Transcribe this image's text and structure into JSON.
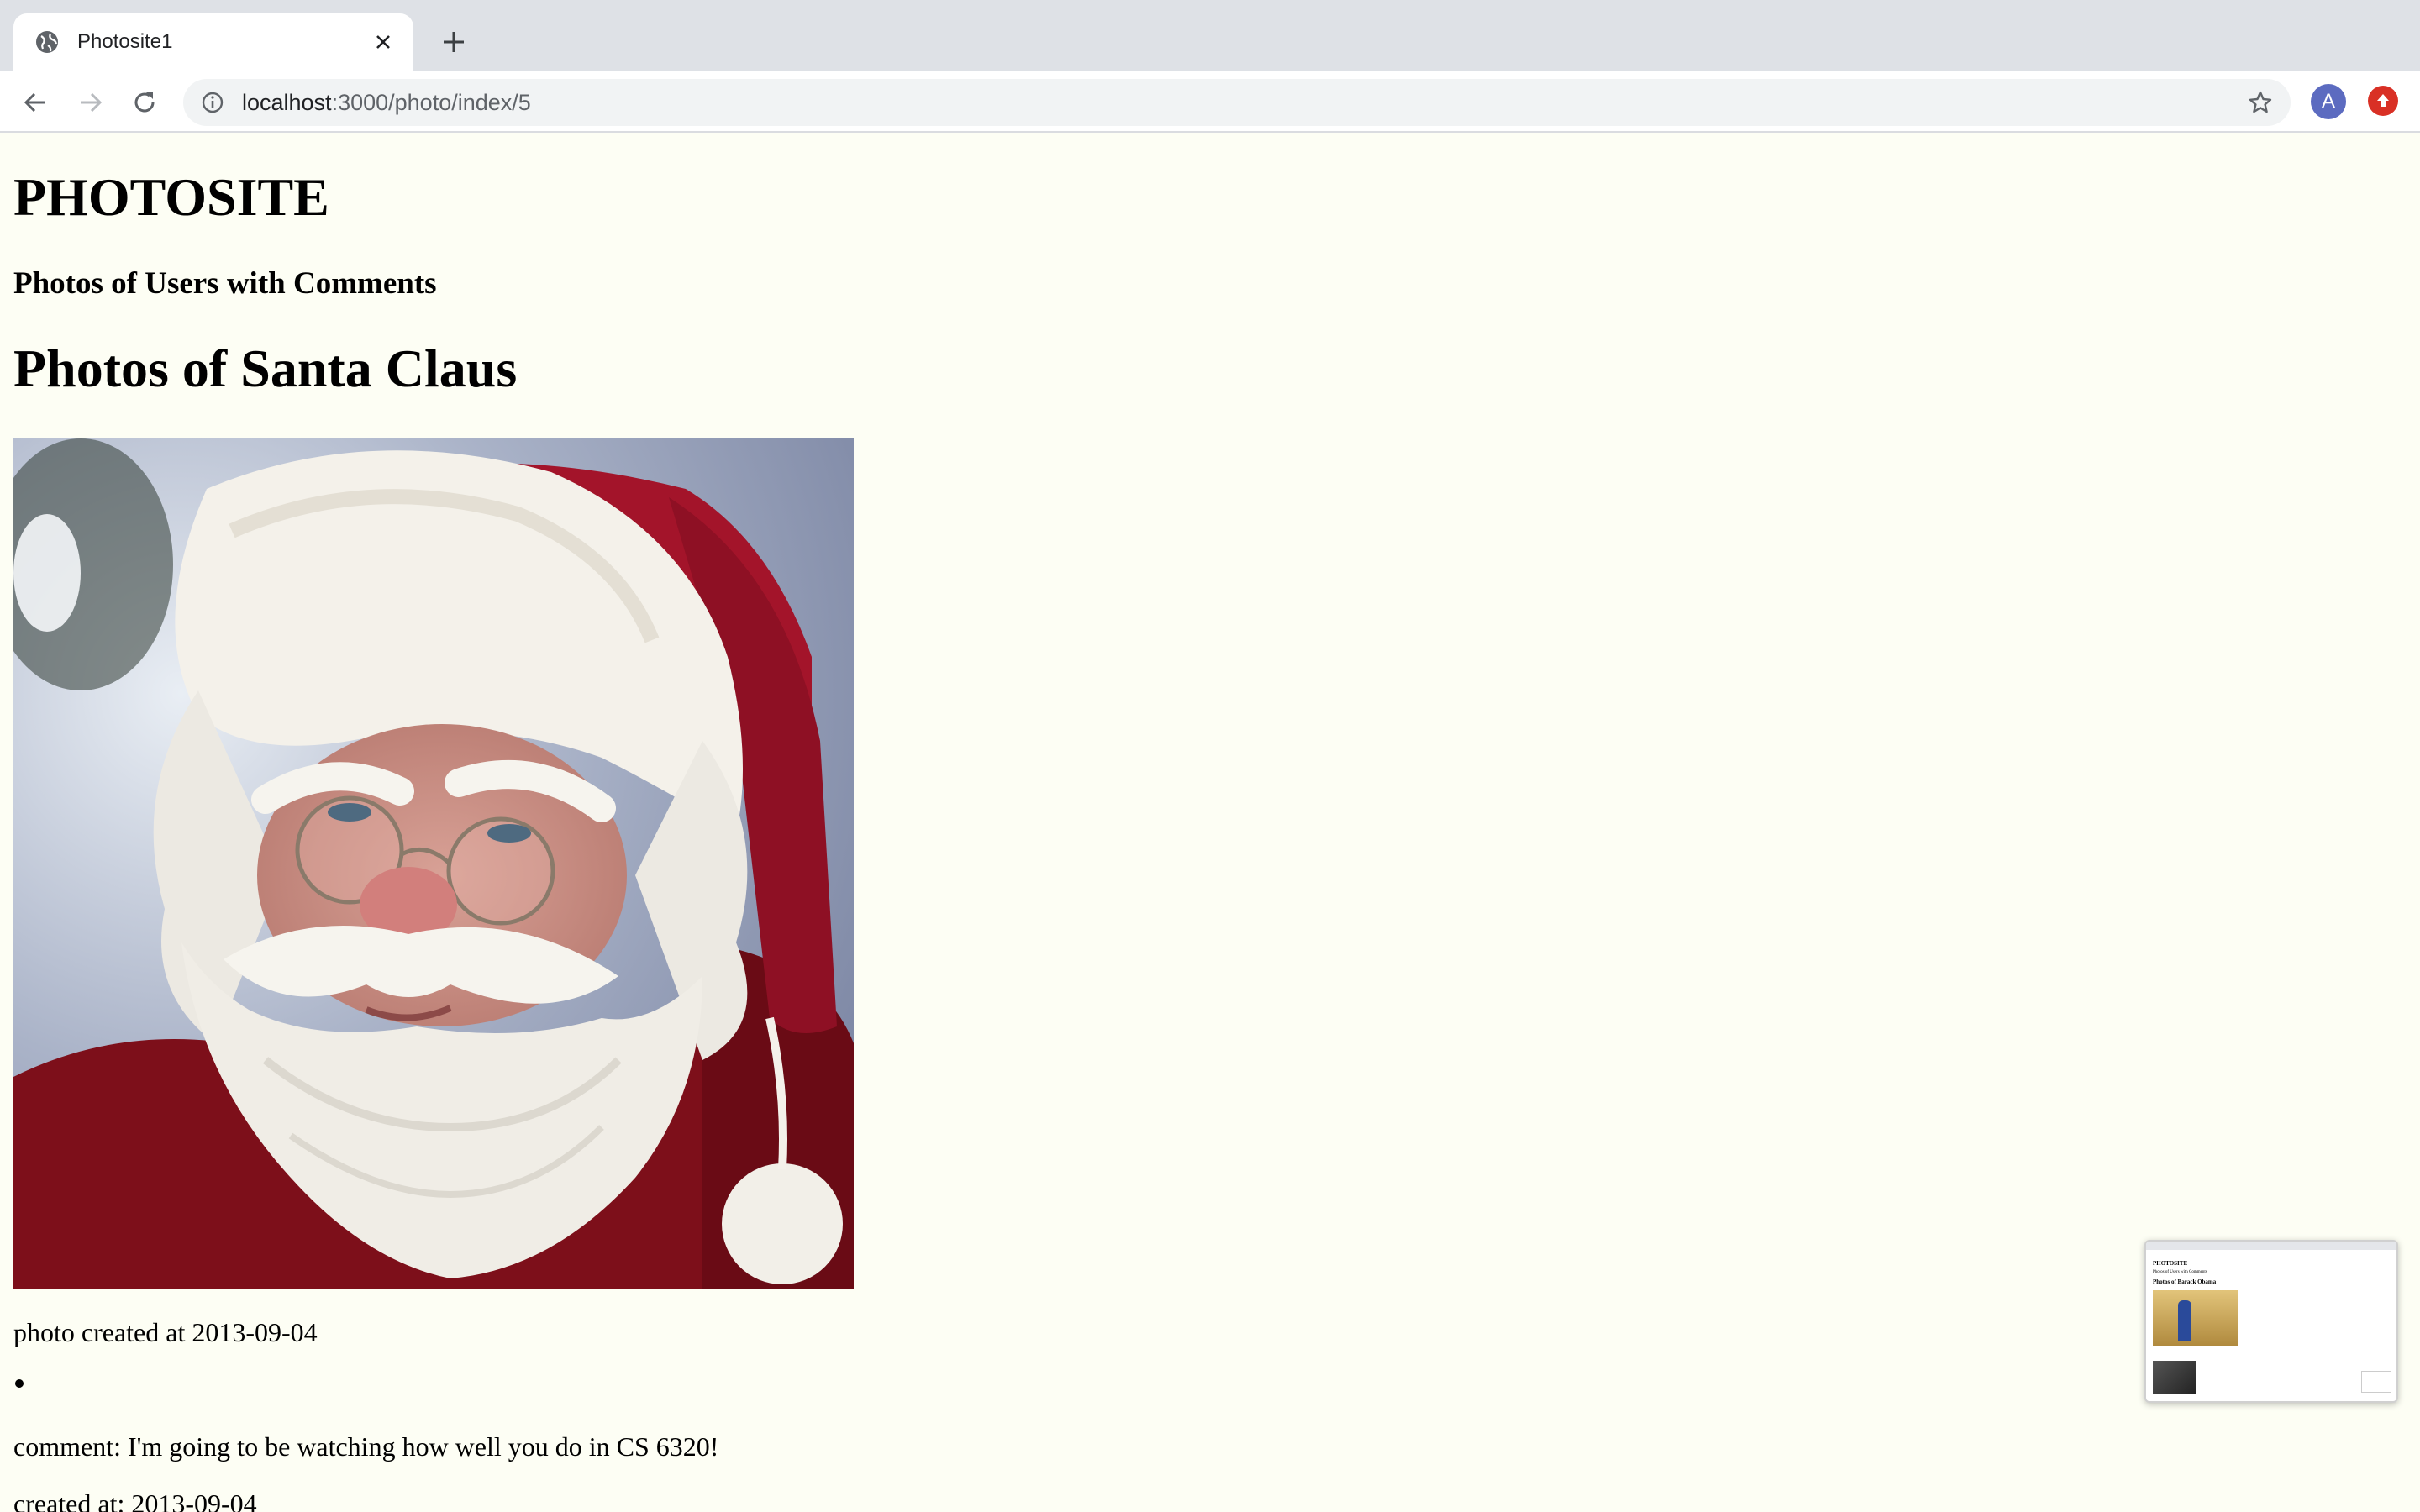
{
  "browser": {
    "tab_title": "Photosite1",
    "url_host": "localhost",
    "url_path": ":3000/photo/index/5",
    "avatar_letter": "A"
  },
  "page": {
    "site_title": "PHOTOSITE",
    "site_subtitle": "Photos of Users with Comments",
    "user_heading": "Photos of Santa Claus",
    "photo_created": "photo created at 2013-09-04",
    "comments": [
      {
        "text": "comment: I'm going to be watching how well you do in CS 6320!",
        "created": "created at: 2013-09-04"
      }
    ]
  },
  "preview": {
    "title": "PHOTOSITE",
    "subtitle": "Photos of Users with Comments",
    "heading": "Photos of Barack Obama"
  },
  "colors": {
    "page_background": "#fdfef4",
    "avatar": "#5c6bc0",
    "extension": "#d93025"
  },
  "icons": [
    "globe-icon",
    "close-icon",
    "plus-icon",
    "back-arrow-icon",
    "forward-arrow-icon",
    "reload-icon",
    "info-icon",
    "star-icon",
    "upload-icon"
  ]
}
